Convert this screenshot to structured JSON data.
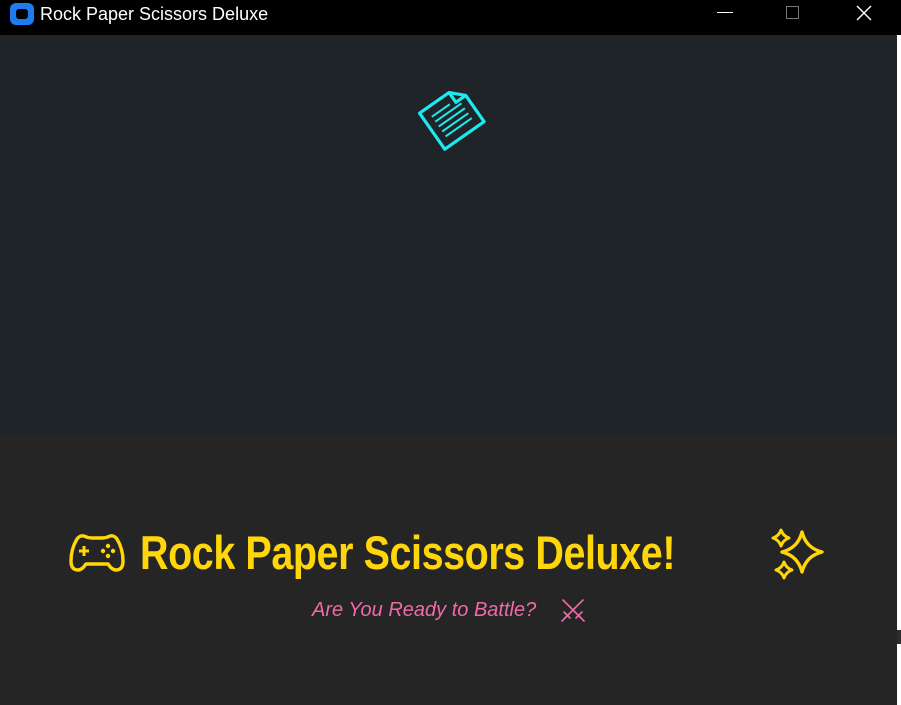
{
  "window": {
    "title": "Rock Paper Scissors Deluxe",
    "icon": "app-icon",
    "controls": [
      "minimize",
      "maximize",
      "close"
    ]
  },
  "stage": {
    "choice_icon": "paper-icon",
    "choice_color": "#1ee8f0",
    "background": "#1e2427"
  },
  "banner": {
    "headline": "Rock Paper Scissors Deluxe!",
    "headline_color": "#ffd60a",
    "left_icon": "gamepad-icon",
    "right_icon": "sparkle-icon",
    "subtitle": "Are You Ready to Battle?",
    "subtitle_color": "#f06aa8",
    "subtitle_icon": "swords-icon",
    "background": "#252525"
  }
}
